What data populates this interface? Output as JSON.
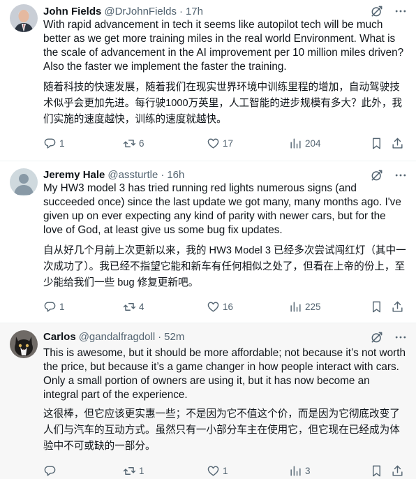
{
  "tweets": [
    {
      "name": "John Fields",
      "handle": "@DrJohnFields",
      "separator": "·",
      "time": "17h",
      "text_en": "With rapid advancement in tech it seems like autopilot tech will be much better as we get more training miles in the real world Environment. What is the scale of advancement in the AI improvement per 10 million miles driven? Also the faster we implement the faster the training.",
      "text_zh": "随着科技的快速发展，随着我们在现实世界环境中训练里程的增加，自动驾驶技术似乎会更加先进。每行驶1000万英里，人工智能的进步规模有多大？此外，我们实施的速度越快，训练的速度就越快。",
      "replies": "1",
      "retweets": "6",
      "likes": "17",
      "views": "204",
      "avatar": "man-in-suit-portrait"
    },
    {
      "name": "Jeremy Hale",
      "handle": "@assturtle",
      "separator": "·",
      "time": "16h",
      "text_en": "My HW3 model 3 has tried running red lights numerous signs (and succeeded once) since the last update we got many, many months ago. I've given up on ever expecting any kind of parity with newer cars, but for the love of God, at least give us some bug fix updates.",
      "text_zh": "自从好几个月前上次更新以来，我的 HW3 Model 3 已经多次尝试闯红灯（其中一次成功了）。我已经不指望它能和新车有任何相似之处了，但看在上帝的份上，至少能给我们一些 bug 修复更新吧。",
      "replies": "1",
      "retweets": "4",
      "likes": "16",
      "views": "225",
      "avatar": "default-person-avatar"
    },
    {
      "name": "Carlos",
      "handle": "@gandalfragdoll",
      "separator": "·",
      "time": "52m",
      "text_en": "This is awesome, but it should be more affordable; not because it’s not worth the price, but because it’s a game changer in how people interact with cars. Only a small portion of owners are using it, but it has now become an integral part of the experience.",
      "text_zh": "这很棒，但它应该更实惠一些；不是因为它不值这个价，而是因为它彻底改变了人们与汽车的互动方式。虽然只有一小部分车主在使用它，但它现在已经成为体验中不可或缺的一部分。",
      "replies": "",
      "retweets": "1",
      "likes": "1",
      "views": "3",
      "avatar": "cat-photo"
    }
  ],
  "colors": {
    "text_primary": "#0f1419",
    "text_secondary": "#536471",
    "divider": "#eff3f4",
    "highlight_bg": "#f7f7f7"
  }
}
